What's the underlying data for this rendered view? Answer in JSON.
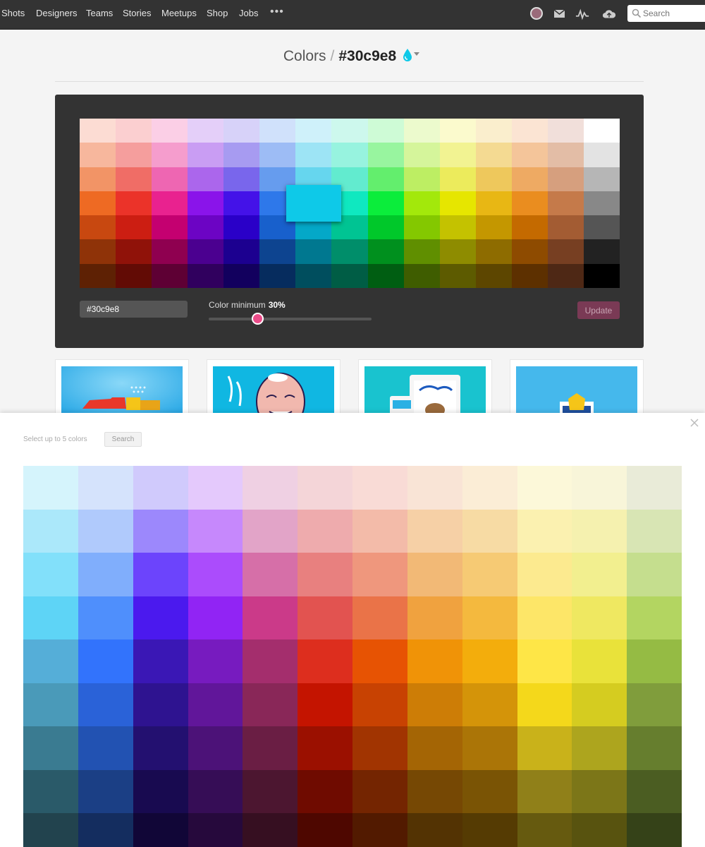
{
  "nav": {
    "items": [
      "Shots",
      "Designers",
      "Teams",
      "Stories",
      "Meetups",
      "Shop",
      "Jobs"
    ],
    "more": "•••",
    "search_placeholder": "Search"
  },
  "header": {
    "crumb": "Colors",
    "separator": "/",
    "hex": "#30c9e8"
  },
  "picker": {
    "hex_value": "#30c9e8",
    "min_label": "Color minimum",
    "min_value": "30%",
    "min_fraction": 0.3,
    "update_label": "Update",
    "selected_color": "#0ec9e8",
    "palette": [
      [
        "#fcdcd3",
        "#fbcfd0",
        "#fbcfe6",
        "#e4cff9",
        "#d7d2f9",
        "#d0e1fb",
        "#cff1fa",
        "#cdf8ed",
        "#cefbd6",
        "#ecfacd",
        "#fbfacd",
        "#faeecd",
        "#fbe4d3",
        "#f1dfda",
        "#ffffff"
      ],
      [
        "#f7b79d",
        "#f59e9d",
        "#f59dcd",
        "#c99df3",
        "#a79bf1",
        "#9dbcf5",
        "#9de4f5",
        "#97f3df",
        "#98f59f",
        "#d5f59b",
        "#f2f392",
        "#f4da92",
        "#f4c59a",
        "#e3bda6",
        "#e3e3e3"
      ],
      [
        "#f29466",
        "#f06d66",
        "#ee66b2",
        "#ab66ec",
        "#7966ec",
        "#669cee",
        "#66d6ee",
        "#62ebcf",
        "#63ee6d",
        "#bdee63",
        "#eceb5c",
        "#eec85c",
        "#eeaa63",
        "#d69f7e",
        "#b6b6b6"
      ],
      [
        "#ee6a23",
        "#eb3329",
        "#e9228f",
        "#8a14ea",
        "#4412e8",
        "#2e78ea",
        "#0ec9e8",
        "#0fe8c0",
        "#0bed3b",
        "#a3e80b",
        "#e6e600",
        "#e8b714",
        "#ea8d1f",
        "#c57a4a",
        "#888888"
      ],
      [
        "#c84810",
        "#cc1e12",
        "#c40070",
        "#6c04c4",
        "#2a00c8",
        "#1860cc",
        "#04a8c8",
        "#00c493",
        "#00c82a",
        "#84c800",
        "#c4c200",
        "#c49700",
        "#c46a00",
        "#a35c33",
        "#555555"
      ],
      [
        "#8f3308",
        "#901209",
        "#8f0050",
        "#4b0090",
        "#1c0090",
        "#0d4490",
        "#007890",
        "#008e6a",
        "#00901e",
        "#608f00",
        "#8e8c00",
        "#8e6c00",
        "#8e4b00",
        "#773f22",
        "#222222"
      ],
      [
        "#5e2104",
        "#620b05",
        "#5e0034",
        "#30005e",
        "#12005e",
        "#062c5e",
        "#004e5e",
        "#005d45",
        "#005e12",
        "#3f5d00",
        "#5d5b00",
        "#5d4600",
        "#5d3000",
        "#4e2815",
        "#000000"
      ]
    ]
  },
  "modal": {
    "hint": "Select up to 5 colors",
    "search_label": "Search",
    "palette": [
      [
        "#d5f4fc",
        "#d5e3fc",
        "#d0cafc",
        "#e4c9fc",
        "#efd0e3",
        "#f4d5d8",
        "#f9dbd6",
        "#f9e4d6",
        "#fbedd6",
        "#fcf8d9",
        "#f8f5d9",
        "#e9ebd8"
      ],
      [
        "#abe8fa",
        "#b0cafc",
        "#9c88fc",
        "#c688fc",
        "#e2a4c8",
        "#eeabad",
        "#f3bba9",
        "#f6d0a6",
        "#f7dba4",
        "#fbf1b0",
        "#f5f1af",
        "#d8e5b4"
      ],
      [
        "#82e0fa",
        "#80aefc",
        "#6c44fc",
        "#ab4cfc",
        "#d66fa8",
        "#e8807f",
        "#ef977d",
        "#f2b976",
        "#f6ca74",
        "#fcea8f",
        "#f2ef8f",
        "#c5de8e"
      ],
      [
        "#5ed4f6",
        "#4f8ffc",
        "#4b19ee",
        "#9124f4",
        "#cb3a89",
        "#e25350",
        "#ea7348",
        "#f0a23f",
        "#f4b93e",
        "#fde668",
        "#efe861",
        "#b3d561"
      ],
      [
        "#55aed8",
        "#3273fc",
        "#3a17b5",
        "#771bbf",
        "#a42e6d",
        "#dd2e1e",
        "#e75303",
        "#f09307",
        "#f3ad0c",
        "#fee647",
        "#e9e23a",
        "#95bb44"
      ],
      [
        "#4a9ab9",
        "#2a62d8",
        "#2e1390",
        "#61169a",
        "#892758",
        "#c41400",
        "#c84202",
        "#cd7d06",
        "#d49409",
        "#f4d81b",
        "#d5cc20",
        "#809d3c"
      ],
      [
        "#3a7b91",
        "#2252b2",
        "#231070",
        "#4c1278",
        "#6a1e44",
        "#9b1000",
        "#a13401",
        "#a46505",
        "#ab7507",
        "#c9b21a",
        "#ada51e",
        "#667e2e"
      ],
      [
        "#2a5a69",
        "#1b3f85",
        "#180a50",
        "#360d56",
        "#4c1630",
        "#6f0b00",
        "#742501",
        "#764804",
        "#7a5405",
        "#908019",
        "#7c7618",
        "#4b5d22"
      ],
      [
        "#22434e",
        "#142d5f",
        "#110637",
        "#26093c",
        "#360f21",
        "#4e0700",
        "#521a00",
        "#533303",
        "#553b03",
        "#665a0f",
        "#58530f",
        "#354218"
      ]
    ]
  }
}
